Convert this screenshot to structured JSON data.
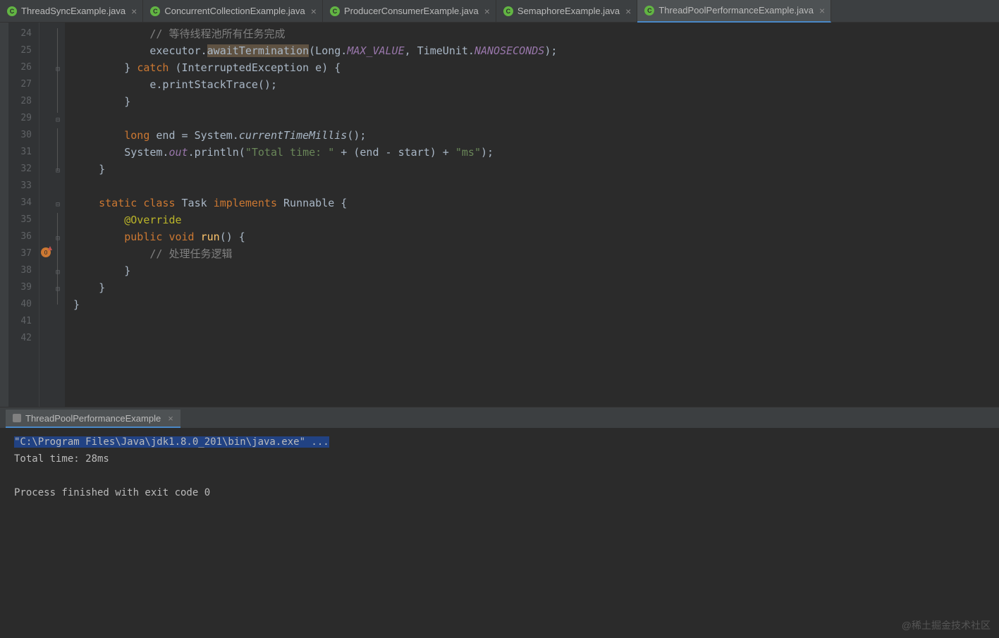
{
  "tabs": [
    {
      "label": "ThreadSyncExample.java",
      "active": false
    },
    {
      "label": "ConcurrentCollectionExample.java",
      "active": false
    },
    {
      "label": "ProducerConsumerExample.java",
      "active": false
    },
    {
      "label": "SemaphoreExample.java",
      "active": false
    },
    {
      "label": "ThreadPoolPerformanceExample.java",
      "active": true
    }
  ],
  "lines": {
    "l24": "// 等待线程池所有任务完成",
    "l25_a": "            executor.",
    "l25_b": "awaitTermination",
    "l25_c": "(Long.",
    "l25_d": "MAX_VALUE",
    "l25_e": ", TimeUnit.",
    "l25_f": "NANOSECONDS",
    "l25_g": ");",
    "l26_a": "        } ",
    "l26_b": "catch",
    "l26_c": " (InterruptedException e) {",
    "l27": "            e.printStackTrace();",
    "l28": "        }",
    "l30_a": "        ",
    "l30_b": "long",
    "l30_c": " end = System.",
    "l30_d": "currentTimeMillis",
    "l30_e": "();",
    "l31_a": "        System.",
    "l31_b": "out",
    "l31_c": ".println(",
    "l31_d": "\"Total time: \"",
    "l31_e": " + (end - start) + ",
    "l31_f": "\"ms\"",
    "l31_g": ");",
    "l32": "    }",
    "l34_a": "    ",
    "l34_b": "static class",
    "l34_c": " Task ",
    "l34_d": "implements",
    "l34_e": " Runnable {",
    "l35": "@Override",
    "l36_a": "        ",
    "l36_b": "public void",
    "l36_c": " ",
    "l36_d": "run",
    "l36_e": "() {",
    "l37": "// 处理任务逻辑",
    "l38": "        }",
    "l39": "    }",
    "l40": "}"
  },
  "line_numbers": [
    "24",
    "25",
    "26",
    "27",
    "28",
    "29",
    "30",
    "31",
    "32",
    "33",
    "34",
    "35",
    "36",
    "37",
    "38",
    "39",
    "40",
    "41",
    "42"
  ],
  "run": {
    "tab_label": "ThreadPoolPerformanceExample",
    "console": {
      "path": "\"C:\\Program Files\\Java\\jdk1.8.0_201\\bin\\java.exe\" ...",
      "out1": "Total time: 28ms",
      "out2": "",
      "out3": "Process finished with exit code 0"
    }
  },
  "watermark": "@稀土掘金技术社区"
}
